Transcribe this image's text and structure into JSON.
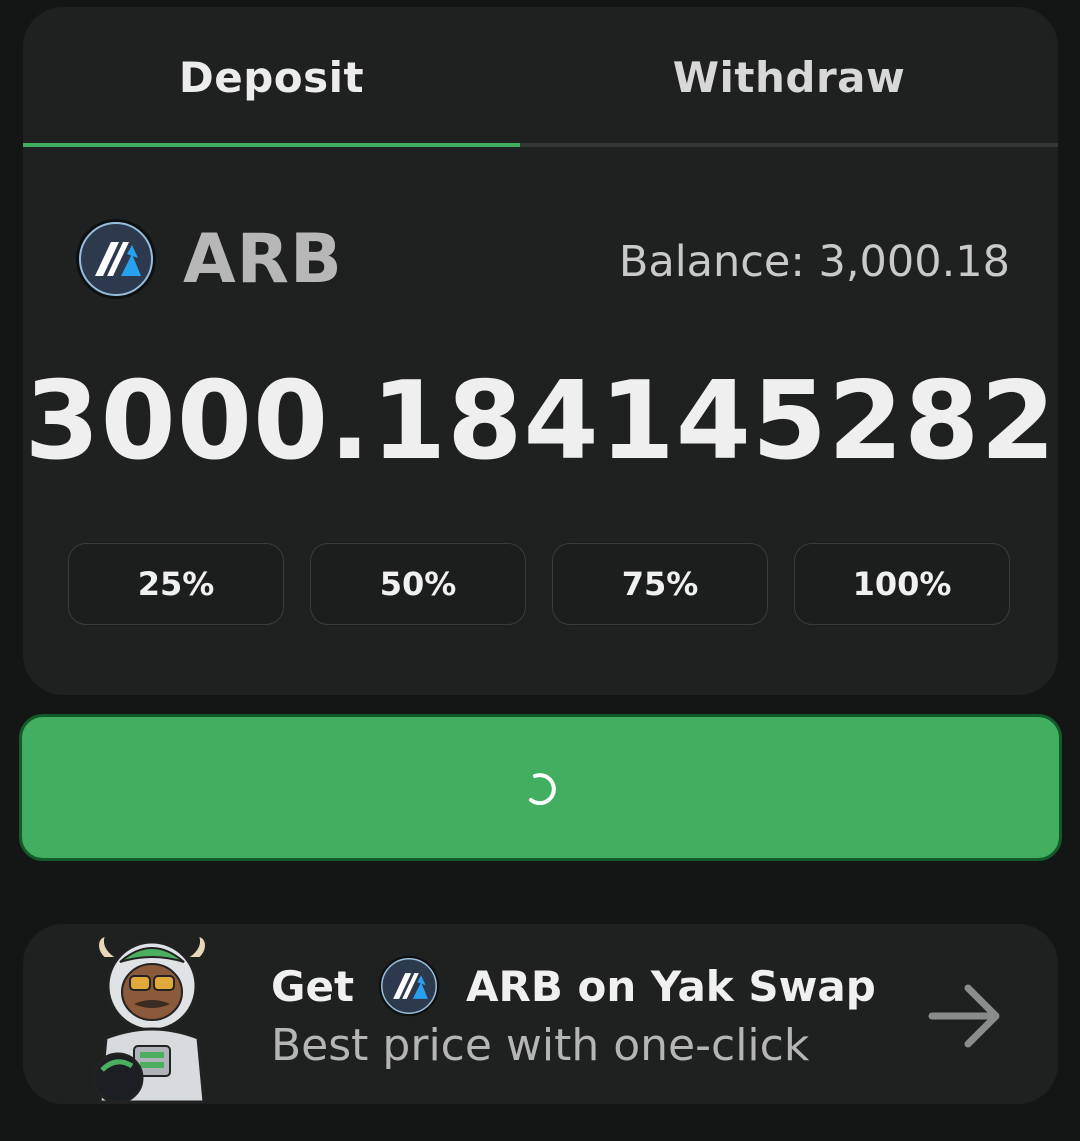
{
  "tabs": {
    "deposit_label": "Deposit",
    "withdraw_label": "Withdraw",
    "active": "Deposit"
  },
  "token": {
    "symbol": "ARB",
    "icon": "arbitrum-logo-icon",
    "balance_label": "Balance: 3,000.18"
  },
  "amount_input": {
    "value": "3000.184145282"
  },
  "percent_buttons": [
    "25%",
    "50%",
    "75%",
    "100%"
  ],
  "deposit_button": {
    "state": "loading",
    "icon": "loading-spinner-icon"
  },
  "promo": {
    "prefix": "Get",
    "token_symbol": "ARB on Yak Swap",
    "subtitle": "Best price with one-click",
    "icon": "arrow-right-icon"
  },
  "colors": {
    "background": "#141615",
    "card": "#1f2121",
    "accent_green": "#41ae60",
    "tab_active_underline": "#43ad5f",
    "arb_blue": "#28a0f0"
  }
}
